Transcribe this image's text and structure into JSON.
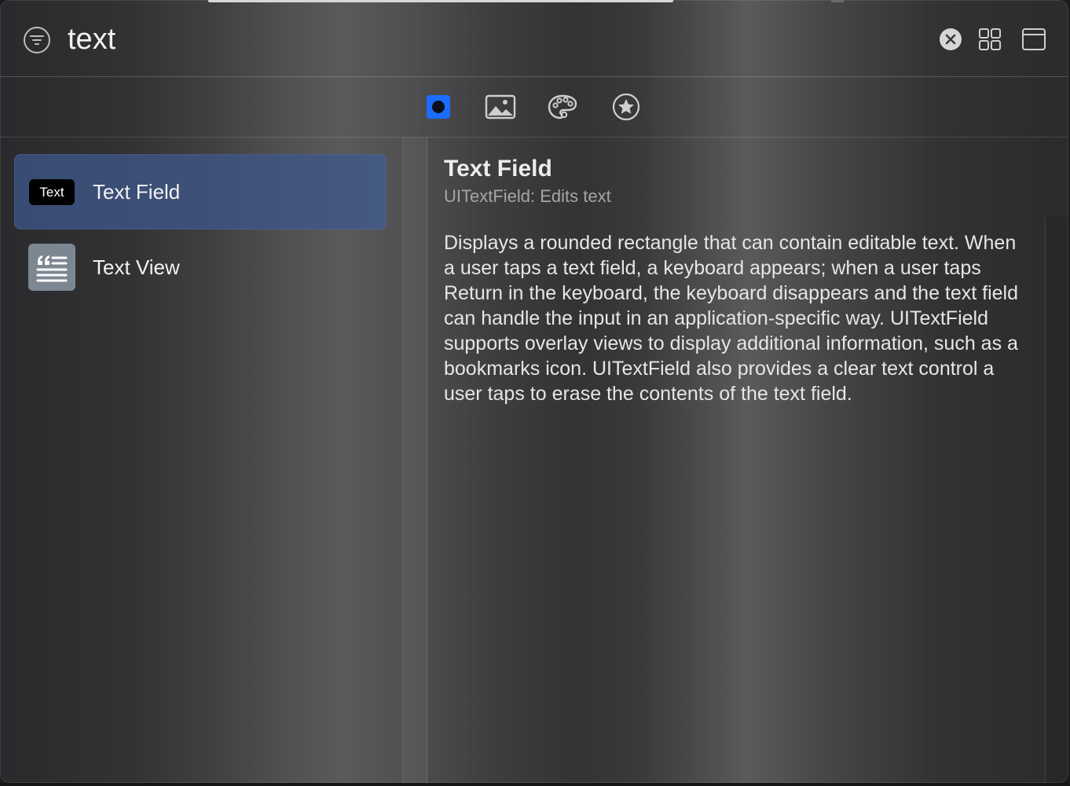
{
  "search": {
    "value": "text"
  },
  "tabs": [
    {
      "icon": "objects-icon"
    },
    {
      "icon": "image-icon"
    },
    {
      "icon": "palette-icon"
    },
    {
      "icon": "star-icon"
    }
  ],
  "list": {
    "items": [
      {
        "label": "Text Field",
        "thumb_text": "Text",
        "selected": true
      },
      {
        "label": "Text View",
        "selected": false
      }
    ]
  },
  "detail": {
    "title": "Text Field",
    "subtitle": "UITextField: Edits text",
    "body": "Displays a rounded rectangle that can contain editable text. When a user taps a text field, a keyboard appears; when a user taps Return in the keyboard, the keyboard disappears and the text field can handle the input in an application-specific way. UITextField supports overlay views to display additional information, such as a bookmarks icon. UITextField also provides a clear text control a user taps to erase the contents of the text field."
  },
  "colors": {
    "accent": "#1a6dff",
    "selection": "#3d5078"
  }
}
